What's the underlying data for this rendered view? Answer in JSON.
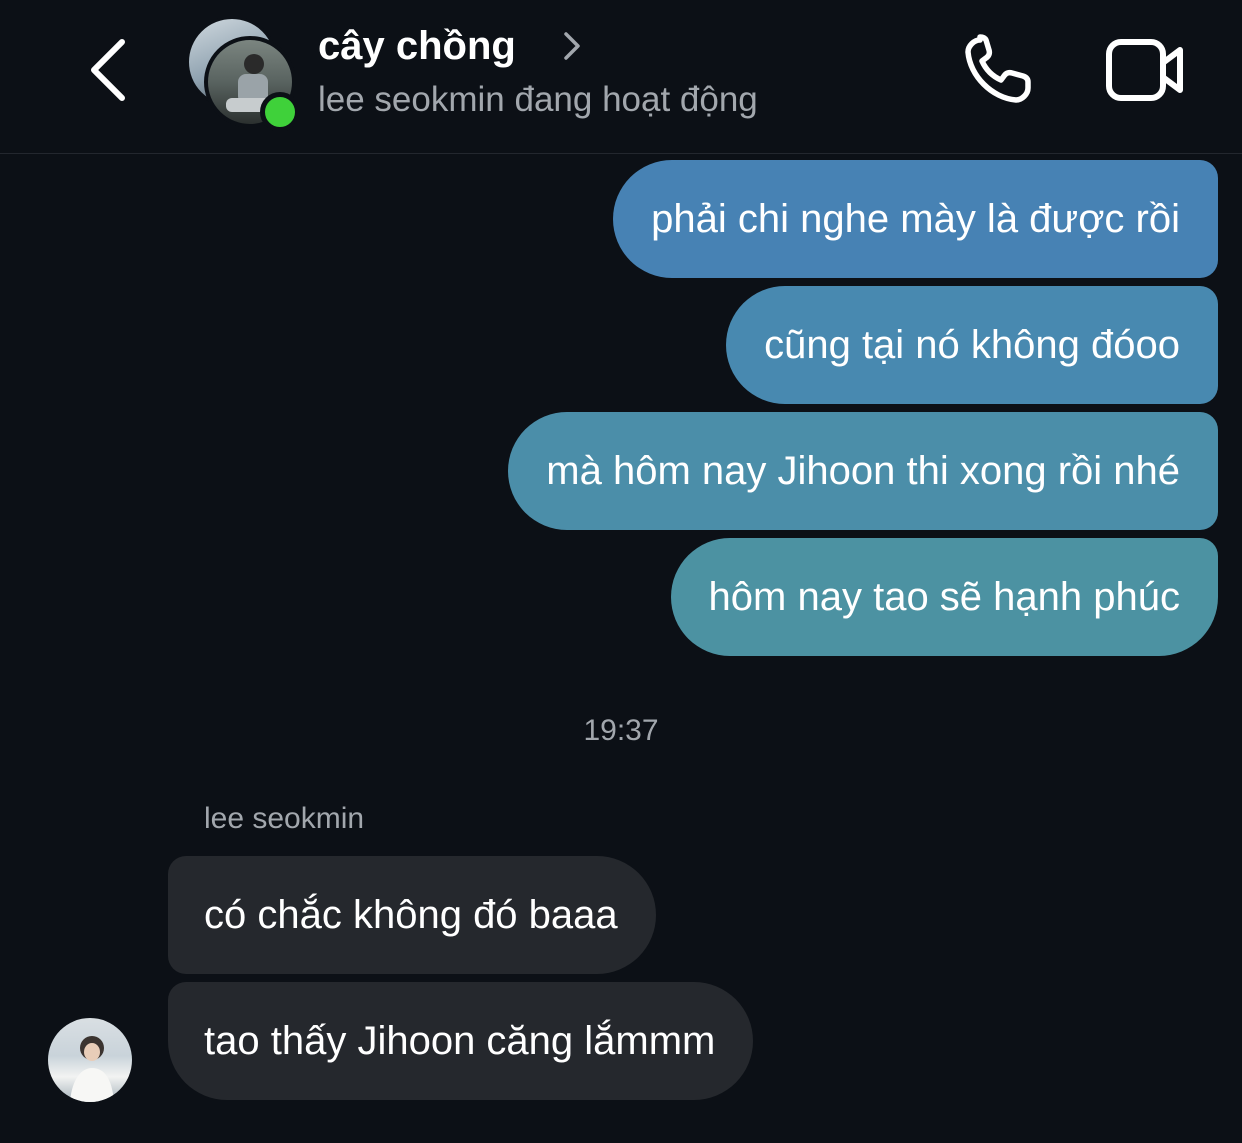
{
  "header": {
    "title": "cây chồng",
    "status": "lee seokmin đang hoạt động",
    "back_icon": "chevron-left-icon",
    "call_icon": "phone-icon",
    "video_icon": "video-camera-icon",
    "online_color": "#3fd13a"
  },
  "messages_outgoing": [
    "phải chi nghe mày là được rồi",
    "cũng tại nó không đóoo",
    "mà hôm nay Jihoon thi xong rồi nhé",
    "hôm nay tao sẽ hạnh phúc"
  ],
  "timestamp": "19:37",
  "incoming": {
    "sender": "lee seokmin",
    "messages": [
      "có chắc không đó baaa",
      "tao thấy Jihoon căng lắmmm"
    ]
  },
  "colors": {
    "background": "#0c1016",
    "outgoing_bubble_start": "#4782b4",
    "outgoing_bubble_end": "#4c92a2",
    "incoming_bubble": "#25282d",
    "secondary_text": "#a2a7ad"
  }
}
